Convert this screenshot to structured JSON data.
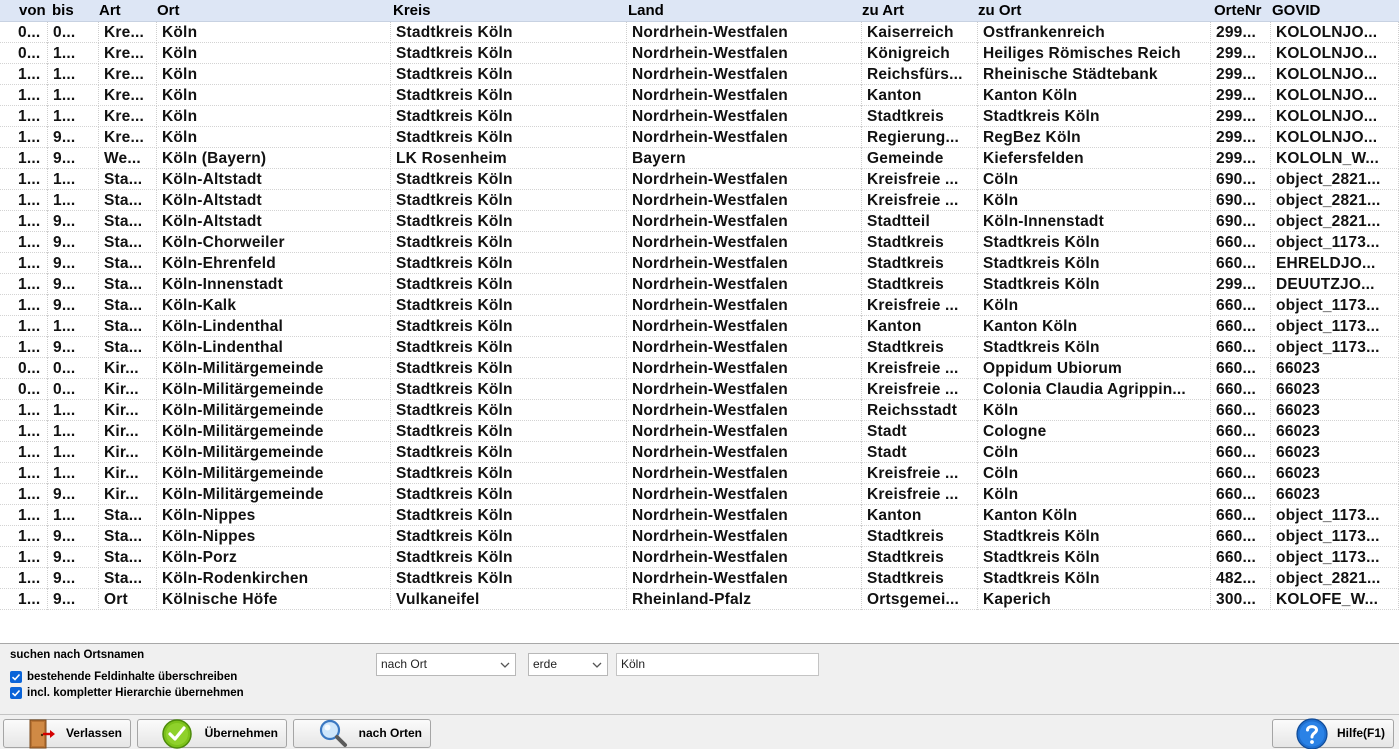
{
  "grid": {
    "columns": [
      {
        "key": "von",
        "label": "von"
      },
      {
        "key": "bis",
        "label": "bis"
      },
      {
        "key": "art",
        "label": "Art"
      },
      {
        "key": "ort",
        "label": "Ort"
      },
      {
        "key": "kreis",
        "label": "Kreis"
      },
      {
        "key": "land",
        "label": "Land"
      },
      {
        "key": "zuart",
        "label": "zu Art"
      },
      {
        "key": "zuort",
        "label": "zu Ort"
      },
      {
        "key": "ortenr",
        "label": "OrteNr"
      },
      {
        "key": "govid",
        "label": "GOVID"
      }
    ],
    "rows": [
      [
        "0...",
        "0...",
        "Kre...",
        "Köln",
        "Stadtkreis Köln",
        "Nordrhein-Westfalen",
        "Kaiserreich",
        "Ostfrankenreich",
        "299...",
        "KOLOLNJO..."
      ],
      [
        "0...",
        "1...",
        "Kre...",
        "Köln",
        "Stadtkreis Köln",
        "Nordrhein-Westfalen",
        "Königreich",
        "Heiliges Römisches Reich",
        "299...",
        "KOLOLNJO..."
      ],
      [
        "1...",
        "1...",
        "Kre...",
        "Köln",
        "Stadtkreis Köln",
        "Nordrhein-Westfalen",
        "Reichsfürs...",
        "Rheinische Städtebank",
        "299...",
        "KOLOLNJO..."
      ],
      [
        "1...",
        "1...",
        "Kre...",
        "Köln",
        "Stadtkreis Köln",
        "Nordrhein-Westfalen",
        "Kanton",
        "Kanton Köln",
        "299...",
        "KOLOLNJO..."
      ],
      [
        "1...",
        "1...",
        "Kre...",
        "Köln",
        "Stadtkreis Köln",
        "Nordrhein-Westfalen",
        "Stadtkreis",
        "Stadtkreis Köln",
        "299...",
        "KOLOLNJO..."
      ],
      [
        "1...",
        "9...",
        "Kre...",
        "Köln",
        "Stadtkreis Köln",
        "Nordrhein-Westfalen",
        "Regierung...",
        "RegBez Köln",
        "299...",
        "KOLOLNJO..."
      ],
      [
        "1...",
        "9...",
        "We...",
        "Köln (Bayern)",
        "LK Rosenheim",
        "Bayern",
        "Gemeinde",
        "Kiefersfelden",
        "299...",
        "KOLOLN_W..."
      ],
      [
        "1...",
        "1...",
        "Sta...",
        "Köln-Altstadt",
        "Stadtkreis Köln",
        "Nordrhein-Westfalen",
        "Kreisfreie ...",
        "Cöln",
        "690...",
        "object_2821..."
      ],
      [
        "1...",
        "1...",
        "Sta...",
        "Köln-Altstadt",
        "Stadtkreis Köln",
        "Nordrhein-Westfalen",
        "Kreisfreie ...",
        "Köln",
        "690...",
        "object_2821..."
      ],
      [
        "1...",
        "9...",
        "Sta...",
        "Köln-Altstadt",
        "Stadtkreis Köln",
        "Nordrhein-Westfalen",
        "Stadtteil",
        "Köln-Innenstadt",
        "690...",
        "object_2821..."
      ],
      [
        "1...",
        "9...",
        "Sta...",
        "Köln-Chorweiler",
        "Stadtkreis Köln",
        "Nordrhein-Westfalen",
        "Stadtkreis",
        "Stadtkreis Köln",
        "660...",
        "object_1173..."
      ],
      [
        "1...",
        "9...",
        "Sta...",
        "Köln-Ehrenfeld",
        "Stadtkreis Köln",
        "Nordrhein-Westfalen",
        "Stadtkreis",
        "Stadtkreis Köln",
        "660...",
        "EHRELDJO..."
      ],
      [
        "1...",
        "9...",
        "Sta...",
        "Köln-Innenstadt",
        "Stadtkreis Köln",
        "Nordrhein-Westfalen",
        "Stadtkreis",
        "Stadtkreis Köln",
        "299...",
        "DEUUTZJO..."
      ],
      [
        "1...",
        "9...",
        "Sta...",
        "Köln-Kalk",
        "Stadtkreis Köln",
        "Nordrhein-Westfalen",
        "Kreisfreie ...",
        "Köln",
        "660...",
        "object_1173..."
      ],
      [
        "1...",
        "1...",
        "Sta...",
        "Köln-Lindenthal",
        "Stadtkreis Köln",
        "Nordrhein-Westfalen",
        "Kanton",
        "Kanton Köln",
        "660...",
        "object_1173..."
      ],
      [
        "1...",
        "9...",
        "Sta...",
        "Köln-Lindenthal",
        "Stadtkreis Köln",
        "Nordrhein-Westfalen",
        "Stadtkreis",
        "Stadtkreis Köln",
        "660...",
        "object_1173..."
      ],
      [
        "0...",
        "0...",
        "Kir...",
        "Köln-Militärgemeinde",
        "Stadtkreis Köln",
        "Nordrhein-Westfalen",
        "Kreisfreie ...",
        "Oppidum Ubiorum",
        "660...",
        "66023"
      ],
      [
        "0...",
        "0...",
        "Kir...",
        "Köln-Militärgemeinde",
        "Stadtkreis Köln",
        "Nordrhein-Westfalen",
        "Kreisfreie ...",
        "Colonia Claudia Agrippin...",
        "660...",
        "66023"
      ],
      [
        "1...",
        "1...",
        "Kir...",
        "Köln-Militärgemeinde",
        "Stadtkreis Köln",
        "Nordrhein-Westfalen",
        "Reichsstadt",
        "Köln",
        "660...",
        "66023"
      ],
      [
        "1...",
        "1...",
        "Kir...",
        "Köln-Militärgemeinde",
        "Stadtkreis Köln",
        "Nordrhein-Westfalen",
        "Stadt",
        "Cologne",
        "660...",
        "66023"
      ],
      [
        "1...",
        "1...",
        "Kir...",
        "Köln-Militärgemeinde",
        "Stadtkreis Köln",
        "Nordrhein-Westfalen",
        "Stadt",
        "Cöln",
        "660...",
        "66023"
      ],
      [
        "1...",
        "1...",
        "Kir...",
        "Köln-Militärgemeinde",
        "Stadtkreis Köln",
        "Nordrhein-Westfalen",
        "Kreisfreie ...",
        "Cöln",
        "660...",
        "66023"
      ],
      [
        "1...",
        "9...",
        "Kir...",
        "Köln-Militärgemeinde",
        "Stadtkreis Köln",
        "Nordrhein-Westfalen",
        "Kreisfreie ...",
        "Köln",
        "660...",
        "66023"
      ],
      [
        "1...",
        "1...",
        "Sta...",
        "Köln-Nippes",
        "Stadtkreis Köln",
        "Nordrhein-Westfalen",
        "Kanton",
        "Kanton Köln",
        "660...",
        "object_1173..."
      ],
      [
        "1...",
        "9...",
        "Sta...",
        "Köln-Nippes",
        "Stadtkreis Köln",
        "Nordrhein-Westfalen",
        "Stadtkreis",
        "Stadtkreis Köln",
        "660...",
        "object_1173..."
      ],
      [
        "1...",
        "9...",
        "Sta...",
        "Köln-Porz",
        "Stadtkreis Köln",
        "Nordrhein-Westfalen",
        "Stadtkreis",
        "Stadtkreis Köln",
        "660...",
        "object_1173..."
      ],
      [
        "1...",
        "9...",
        "Sta...",
        "Köln-Rodenkirchen",
        "Stadtkreis Köln",
        "Nordrhein-Westfalen",
        "Stadtkreis",
        "Stadtkreis Köln",
        "482...",
        "object_2821..."
      ],
      [
        "1...",
        "9...",
        "Ort",
        "Kölnische Höfe",
        "Vulkaneifel",
        "Rheinland-Pfalz",
        "Ortsgemei...",
        "Kaperich",
        "300...",
        "KOLOFE_W..."
      ]
    ]
  },
  "search": {
    "title": "suchen nach Ortsnamen",
    "overwrite_label": "bestehende Feldinhalte überschreiben",
    "overwrite_checked": true,
    "hierarchy_label": "incl. kompletter Hierarchie übernehmen",
    "hierarchy_checked": true,
    "mode_select": "nach Ort",
    "scope_select": "erde",
    "query_value": "Köln"
  },
  "toolbar": {
    "exit_label": "Verlassen",
    "exit_icon": "door-exit-icon",
    "accept_label": "Übernehmen",
    "accept_icon": "checkmark-icon",
    "search_label": "nach Orten",
    "search_icon": "magnifier-icon",
    "help_label": "Hilfe(F1)",
    "help_icon": "question-icon"
  }
}
